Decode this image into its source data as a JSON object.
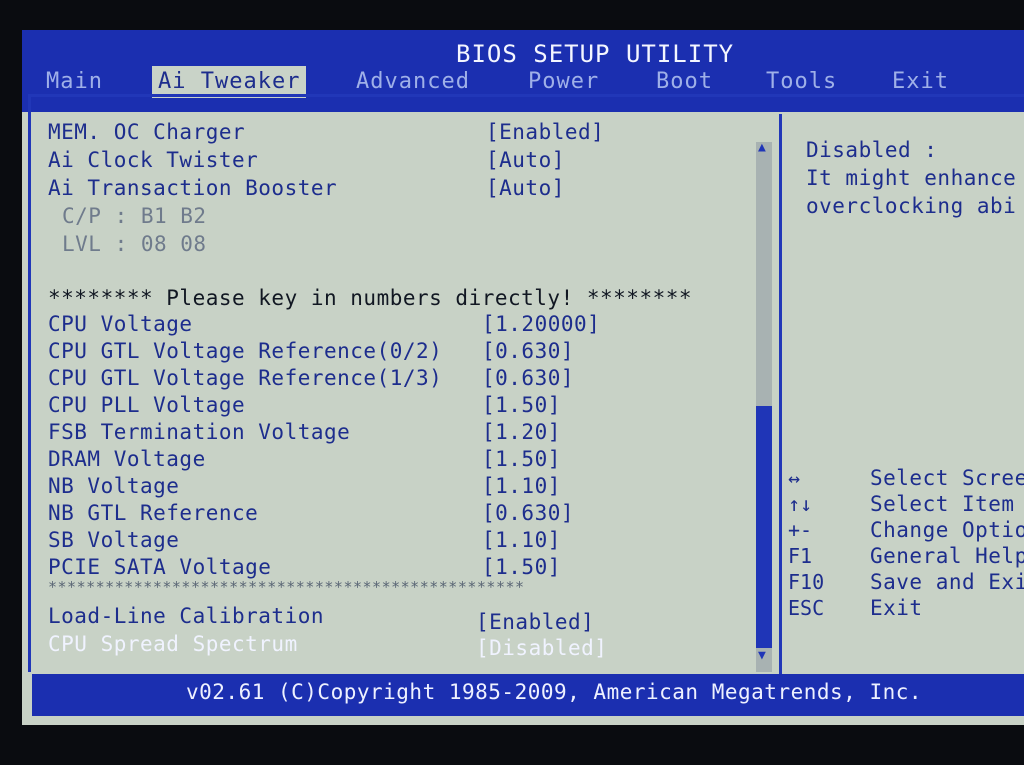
{
  "title": "BIOS SETUP UTILITY",
  "menu": [
    "Main",
    "Ai Tweaker",
    "Advanced",
    "Power",
    "Boot",
    "Tools",
    "Exit"
  ],
  "active_menu": "Ai Tweaker",
  "settings_top": [
    {
      "label": "MEM. OC Charger",
      "value": "[Enabled]"
    },
    {
      "label": "Ai Clock Twister",
      "value": "[Auto]"
    },
    {
      "label": "Ai Transaction Booster",
      "value": "[Auto]"
    }
  ],
  "info_lines": [
    "C/P : B1 B2",
    "LVL : 08 08"
  ],
  "voltage_note": "******** Please key in numbers directly! ********",
  "voltages": [
    {
      "label": "CPU Voltage",
      "value": "[1.20000]"
    },
    {
      "label": "CPU GTL Voltage Reference(0/2)",
      "value": "[0.630]"
    },
    {
      "label": "CPU GTL Voltage Reference(1/3)",
      "value": "[0.630]"
    },
    {
      "label": "CPU PLL Voltage",
      "value": "[1.50]"
    },
    {
      "label": "FSB Termination Voltage",
      "value": "[1.20]"
    },
    {
      "label": "DRAM Voltage",
      "value": "[1.50]"
    },
    {
      "label": "NB Voltage",
      "value": "[1.10]"
    },
    {
      "label": "NB GTL Reference",
      "value": "[0.630]"
    },
    {
      "label": "SB Voltage",
      "value": "[1.10]"
    },
    {
      "label": "PCIE SATA Voltage",
      "value": "[1.50]"
    }
  ],
  "separator": "**************************************************",
  "settings_bottom": [
    {
      "label": "Load-Line Calibration",
      "value": "[Enabled]"
    },
    {
      "label": "CPU Spread Spectrum",
      "value": "[Disabled]"
    }
  ],
  "help_text": [
    "Disabled :",
    "It might enhance",
    "overclocking abi"
  ],
  "keys": [
    {
      "key": "↔",
      "desc": "Select Screen"
    },
    {
      "key": "↑↓",
      "desc": "Select Item"
    },
    {
      "key": "+-",
      "desc": "Change Option"
    },
    {
      "key": "F1",
      "desc": "General Help"
    },
    {
      "key": "F10",
      "desc": "Save and Exit"
    },
    {
      "key": "ESC",
      "desc": "Exit"
    }
  ],
  "footer": "v02.61 (C)Copyright 1985-2009, American Megatrends, Inc.",
  "colors": {
    "bar_blue": "#1b2fb0",
    "screen_bg": "#c8d2c6",
    "text_blue": "#1d2d8d",
    "selected_text": "#f0f3ff"
  }
}
